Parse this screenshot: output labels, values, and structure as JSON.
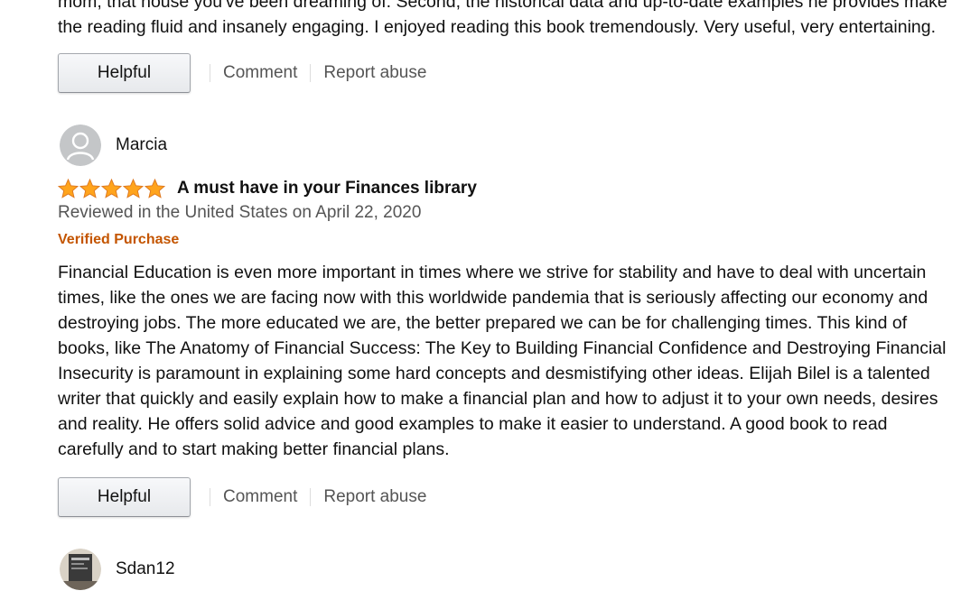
{
  "previous_review": {
    "lines": [
      "mom, that house you've been dreaming of. Second, the historical data and up-to-date examples he provides make",
      "the reading fluid and insanely engaging. I enjoyed reading this book tremendously. Very useful, very entertaining."
    ],
    "actions": {
      "helpful": "Helpful",
      "comment": "Comment",
      "report": "Report abuse"
    }
  },
  "review": {
    "reviewer": "Marcia",
    "rating": 5,
    "rating_max": 5,
    "title": "A must have in your Finances library",
    "date": "Reviewed in the United States on April 22, 2020",
    "verified": "Verified Purchase",
    "body_lines": [
      "Financial Education is even more important in times where we strive for stability and have to deal with uncertain",
      "times, like the ones we are facing now with this worldwide pandemia that is seriously affecting our economy and",
      "destroying jobs. The more educated we are, the better prepared we can be for challenging times. This kind of",
      "books, like The Anatomy of Financial Success: The Key to Building Financial Confidence and Destroying Financial",
      "Insecurity is paramount in explaining some hard concepts and desmistifying other ideas. Elijah Bilel is a talented",
      "writer that quickly and easily explain how to make a financial plan and how to adjust it to your own needs, desires",
      "and reality. He offers solid advice and good examples to make it easier to understand. A good book to read",
      "carefully and to start making better financial plans."
    ],
    "actions": {
      "helpful": "Helpful",
      "comment": "Comment",
      "report": "Report abuse"
    }
  },
  "next_review": {
    "reviewer": "Sdan12"
  },
  "colors": {
    "verified": "#c45500",
    "star": "#ffa41c",
    "secondary_text": "#555555"
  },
  "icons": {
    "default_avatar": "default-avatar-icon",
    "star": "star-icon",
    "photo_avatar": "photo-avatar-icon"
  }
}
